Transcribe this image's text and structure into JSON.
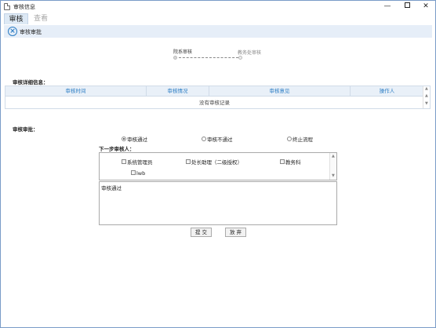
{
  "window": {
    "title": "审核信息",
    "min_glyph": "—",
    "close_glyph": "✕"
  },
  "tabs": [
    {
      "label": "审核"
    },
    {
      "label": "查看"
    }
  ],
  "toolbar": {
    "close_glyph": "×",
    "label": "审核审批"
  },
  "workflow": {
    "steps": [
      {
        "label": "院系审核",
        "status": "current"
      },
      {
        "label": "教务处审核",
        "status": "pending"
      }
    ]
  },
  "detail": {
    "title": "审核详细信息：",
    "columns": [
      "审核时间",
      "审核情况",
      "审核意见",
      "操作人"
    ],
    "rows": [],
    "empty_text": "没有审核记录"
  },
  "approval": {
    "title": "审核审批：",
    "options": [
      {
        "label": "审核通过",
        "selected": true
      },
      {
        "label": "审核不通过",
        "selected": false
      },
      {
        "label": "终止流程",
        "selected": false
      }
    ],
    "next_label": "下一步审核人：",
    "approvers": [
      {
        "label": "系统管理员",
        "checked": false
      },
      {
        "label": "处长助理（二级授权）",
        "checked": false
      },
      {
        "label": "教务科",
        "checked": false
      },
      {
        "label": "lwb",
        "checked": false
      }
    ],
    "comment": "审核通过",
    "submit_label": "提 交",
    "cancel_label": "放 弃"
  }
}
